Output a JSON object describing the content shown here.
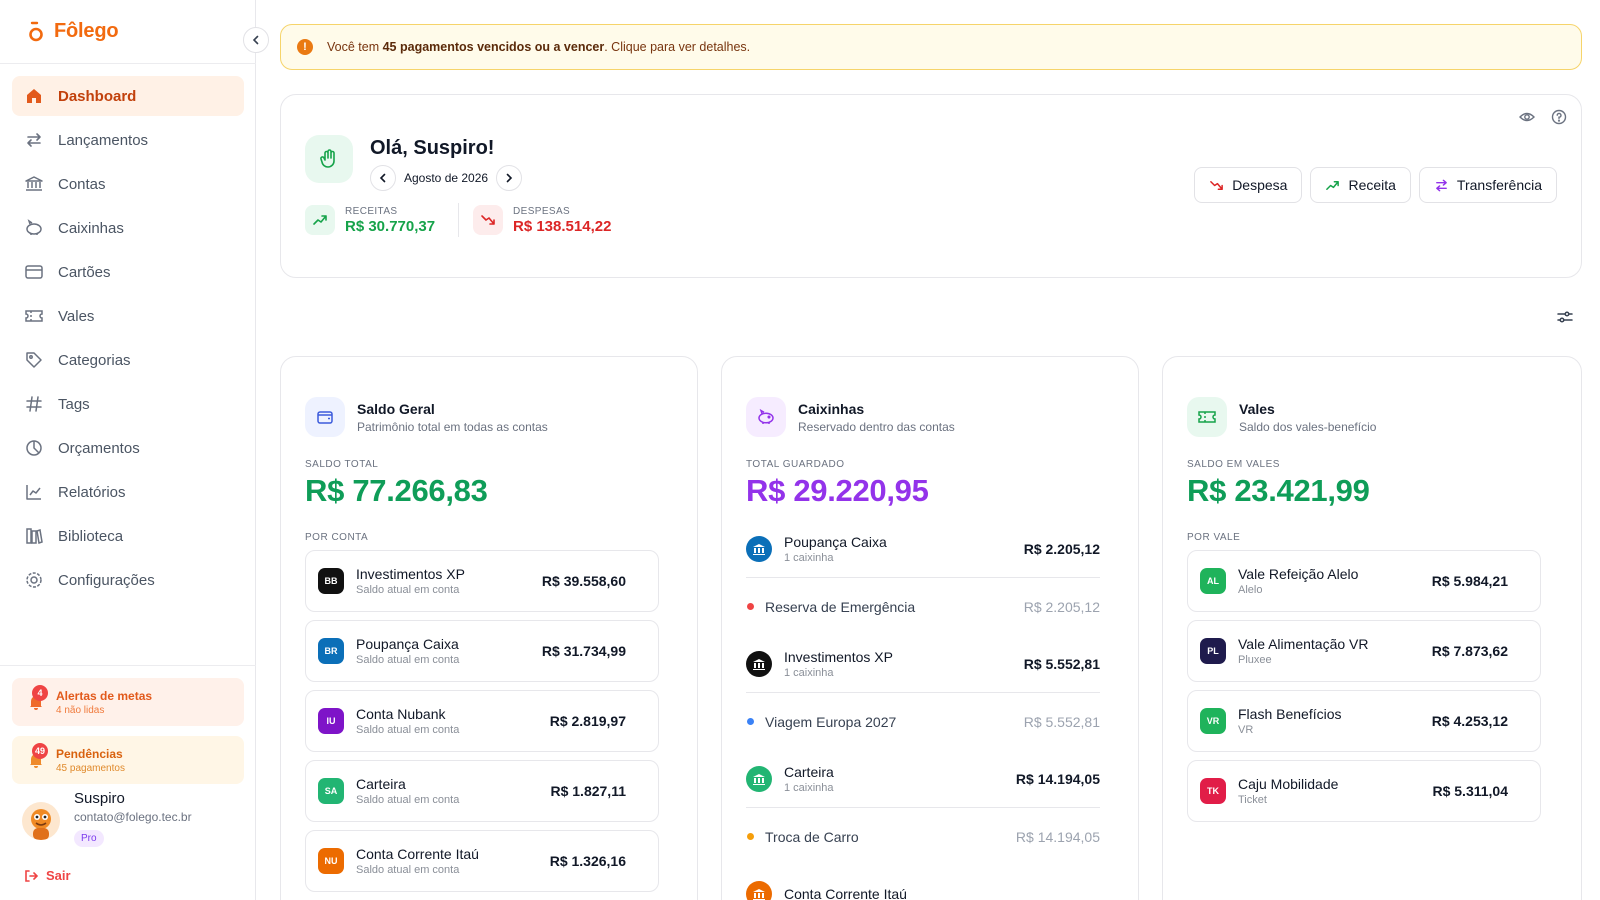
{
  "app": {
    "name": "Fôlego",
    "accent": "#f26a0f"
  },
  "sidebar": {
    "items": [
      {
        "label": "Dashboard",
        "icon": "home-icon",
        "active": true
      },
      {
        "label": "Lançamentos",
        "icon": "arrows-left-right-icon"
      },
      {
        "label": "Contas",
        "icon": "bank-icon"
      },
      {
        "label": "Caixinhas",
        "icon": "piggy-bank-icon"
      },
      {
        "label": "Cartões",
        "icon": "credit-card-icon"
      },
      {
        "label": "Vales",
        "icon": "ticket-icon"
      },
      {
        "label": "Categorias",
        "icon": "tag-icon"
      },
      {
        "label": "Tags",
        "icon": "hash-icon"
      },
      {
        "label": "Orçamentos",
        "icon": "pie-chart-icon"
      },
      {
        "label": "Relatórios",
        "icon": "line-chart-icon"
      },
      {
        "label": "Biblioteca",
        "icon": "library-icon"
      },
      {
        "label": "Configurações",
        "icon": "settings-icon"
      }
    ],
    "alerts": {
      "metas": {
        "title": "Alertas de metas",
        "sub": "4 não lidas",
        "count": "4"
      },
      "pendencias": {
        "title": "Pendências",
        "sub": "45 pagamentos",
        "count": "49"
      }
    },
    "user": {
      "name": "Suspiro",
      "email": "contato@folego.tec.br",
      "plan": "Pro"
    },
    "logout": "Sair"
  },
  "notice": {
    "prefix": "Você tem",
    "highlight": "45 pagamentos vencidos ou a vencer",
    "suffix": ". Clique para ver detalhes."
  },
  "hero": {
    "greeting": "Olá, Suspiro!",
    "month": "Agosto de 2026",
    "receitas": {
      "label": "RECEITAS",
      "value": "R$ 30.770,37",
      "color": "#16a34a"
    },
    "despesas": {
      "label": "DESPESAS",
      "value": "R$ 138.514,22",
      "color": "#dc2626"
    },
    "actions": {
      "despesa": "Despesa",
      "receita": "Receita",
      "transferencia": "Transferência"
    }
  },
  "saldo": {
    "title": "Saldo Geral",
    "subtitle": "Patrimônio total em todas as contas",
    "total_label": "SALDO TOTAL",
    "total": "R$ 77.266,83",
    "total_color": "#0f9d58",
    "group_label": "POR CONTA",
    "rows": [
      {
        "badge": "BB",
        "color": "#111111",
        "name": "Investimentos XP",
        "sub": "Saldo atual em conta",
        "value": "R$ 39.558,60"
      },
      {
        "badge": "BR",
        "color": "#0b6fb8",
        "name": "Poupança Caixa",
        "sub": "Saldo atual em conta",
        "value": "R$ 31.734,99"
      },
      {
        "badge": "IU",
        "color": "#7e14c8",
        "name": "Conta Nubank",
        "sub": "Saldo atual em conta",
        "value": "R$ 2.819,97"
      },
      {
        "badge": "SA",
        "color": "#22b573",
        "name": "Carteira",
        "sub": "Saldo atual em conta",
        "value": "R$ 1.827,11"
      },
      {
        "badge": "NU",
        "color": "#ec6b00",
        "name": "Conta Corrente Itaú",
        "sub": "Saldo atual em conta",
        "value": "R$ 1.326,16"
      }
    ]
  },
  "caixinhas": {
    "title": "Caixinhas",
    "subtitle": "Reservado dentro das contas",
    "total_label": "TOTAL GUARDADO",
    "total": "R$ 29.220,95",
    "total_color": "#9333ea",
    "rows": [
      {
        "account": "Poupança Caixa",
        "count": "1 caixinha",
        "value": "R$ 2.205,12",
        "logo_color": "#0b6fb8",
        "reserve": "Reserva de Emergência",
        "reserve_value": "R$ 2.205,12",
        "dot": "#ef4444"
      },
      {
        "account": "Investimentos XP",
        "count": "1 caixinha",
        "value": "R$ 5.552,81",
        "logo_color": "#111111",
        "reserve": "Viagem Europa 2027",
        "reserve_value": "R$ 5.552,81",
        "dot": "#3b82f6"
      },
      {
        "account": "Carteira",
        "count": "1 caixinha",
        "value": "R$ 14.194,05",
        "logo_color": "#22b573",
        "reserve": "Troca de Carro",
        "reserve_value": "R$ 14.194,05",
        "dot": "#f59e0b"
      },
      {
        "account": "Conta Corrente Itaú",
        "count": "",
        "value": "",
        "logo_color": "#ec6b00",
        "reserve": "",
        "reserve_value": "",
        "dot": ""
      }
    ]
  },
  "vales": {
    "title": "Vales",
    "subtitle": "Saldo dos vales-benefício",
    "total_label": "SALDO EM VALES",
    "total": "R$ 23.421,99",
    "total_color": "#0f9d58",
    "group_label": "POR VALE",
    "rows": [
      {
        "badge": "AL",
        "color": "#1fb35b",
        "name": "Vale Refeição Alelo",
        "sub": "Alelo",
        "value": "R$ 5.984,21"
      },
      {
        "badge": "PL",
        "color": "#1f1b4d",
        "name": "Vale Alimentação VR",
        "sub": "Pluxee",
        "value": "R$ 7.873,62"
      },
      {
        "badge": "VR",
        "color": "#1fb35b",
        "name": "Flash Benefícios",
        "sub": "VR",
        "value": "R$ 4.253,12"
      },
      {
        "badge": "TK",
        "color": "#e11d48",
        "name": "Caju Mobilidade",
        "sub": "Ticket",
        "value": "R$ 5.311,04"
      }
    ]
  }
}
